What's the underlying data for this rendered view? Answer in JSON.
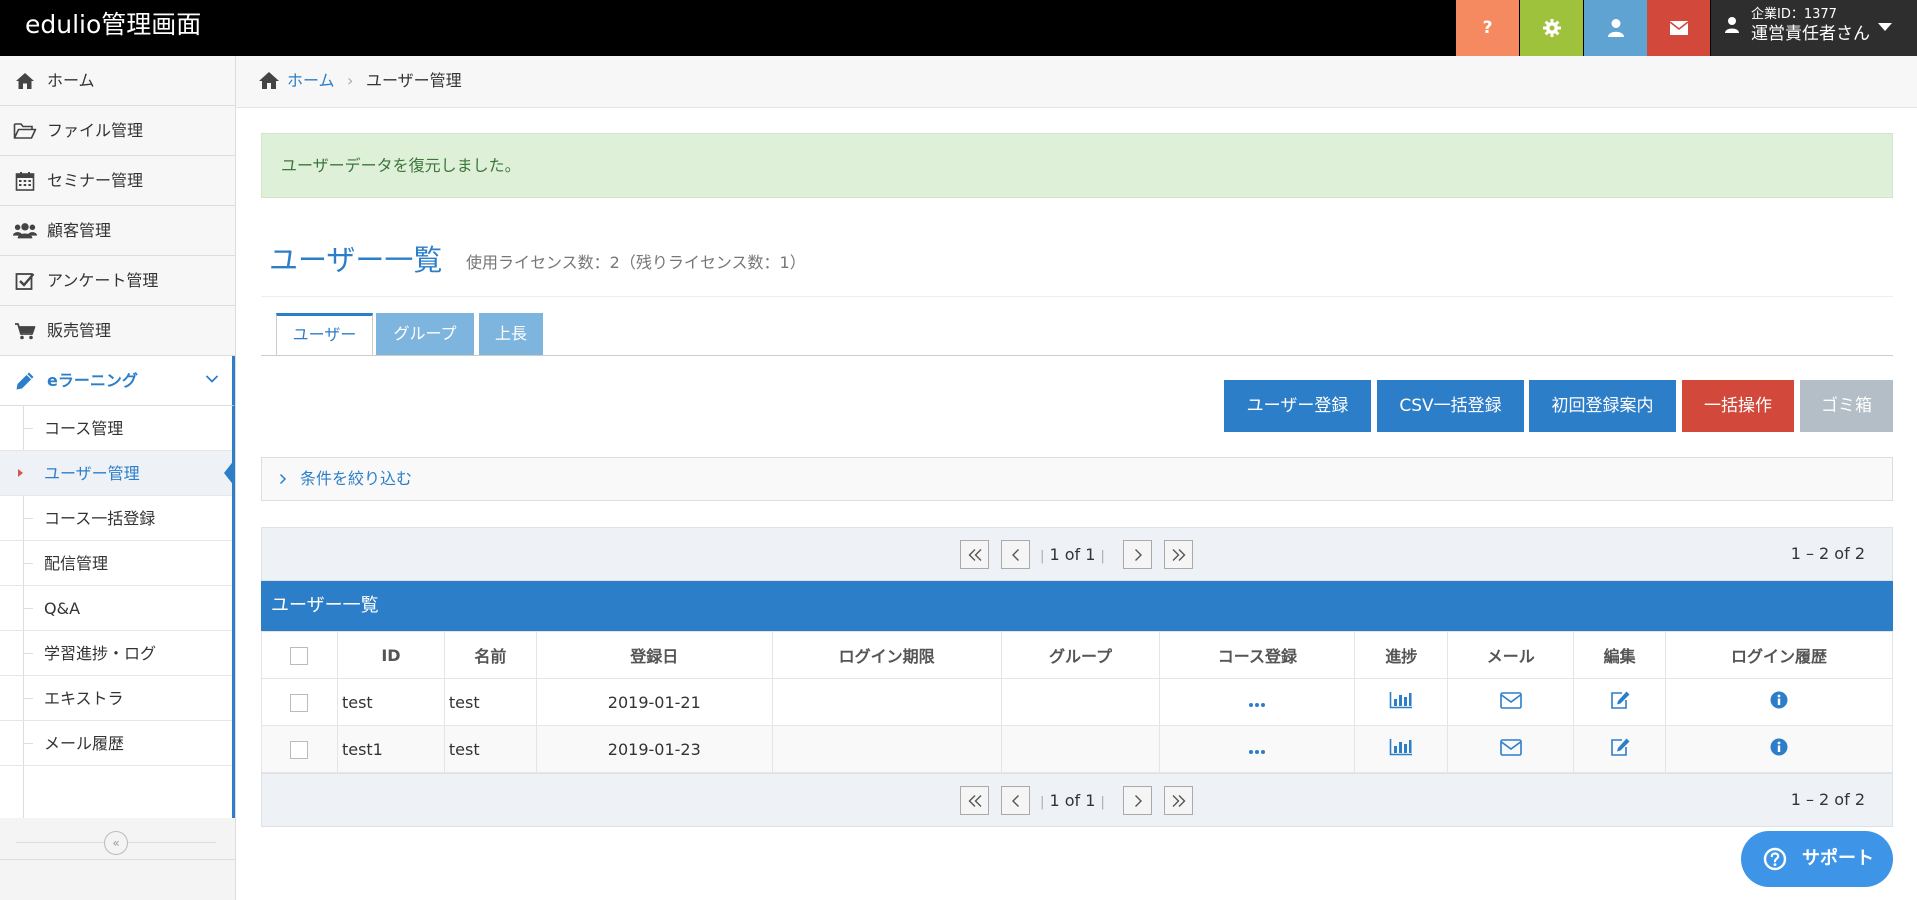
{
  "header": {
    "brand": "edulio管理画面",
    "help_label": "?",
    "company_id": "企業ID：1377",
    "user_name": "運営責任者さん"
  },
  "sidebar": {
    "items": [
      {
        "label": "ホーム",
        "icon": "home-icon"
      },
      {
        "label": "ファイル管理",
        "icon": "folder-open-icon"
      },
      {
        "label": "セミナー管理",
        "icon": "calendar-icon"
      },
      {
        "label": "顧客管理",
        "icon": "users-icon"
      },
      {
        "label": "アンケート管理",
        "icon": "checkbox-icon"
      },
      {
        "label": "販売管理",
        "icon": "cart-icon"
      },
      {
        "label": "eラーニング",
        "icon": "pencil-icon"
      }
    ],
    "subitems": [
      {
        "label": "コース管理"
      },
      {
        "label": "ユーザー管理"
      },
      {
        "label": "コース一括登録"
      },
      {
        "label": "配信管理"
      },
      {
        "label": "Q&A"
      },
      {
        "label": "学習進捗・ログ"
      },
      {
        "label": "エキストラ"
      },
      {
        "label": "メール履歴"
      }
    ],
    "collapse_label": "«"
  },
  "breadcrumb": {
    "home": "ホーム",
    "separator": "›",
    "current": "ユーザー管理"
  },
  "alert": {
    "message": "ユーザーデータを復元しました。"
  },
  "page": {
    "title": "ユーザー一覧",
    "license_info": "使用ライセンス数：2（残りライセンス数：1）"
  },
  "tabs": [
    {
      "label": "ユーザー"
    },
    {
      "label": "グループ"
    },
    {
      "label": "上長"
    }
  ],
  "actions": {
    "register": "ユーザー登録",
    "csv": "CSV一括登録",
    "first_guide": "初回登録案内",
    "bulk": "一括操作",
    "trash": "ゴミ箱"
  },
  "filter": {
    "label": "条件を絞り込む"
  },
  "pager": {
    "page_text": "1 of 1",
    "bar": "|",
    "count_text": "1 – 2 of 2"
  },
  "grid": {
    "title": "ユーザー一覧",
    "columns": [
      "ID",
      "名前",
      "登録日",
      "ログイン期限",
      "グループ",
      "コース登録",
      "進捗",
      "メール",
      "編集",
      "ログイン履歴"
    ],
    "rows": [
      {
        "id": "test",
        "name": "test",
        "date": "2019-01-21",
        "expire": "",
        "group": ""
      },
      {
        "id": "test1",
        "name": "test",
        "date": "2019-01-23",
        "expire": "",
        "group": ""
      }
    ]
  },
  "support": {
    "label": "サポート"
  },
  "colors": {
    "primary": "#2d7ec9",
    "danger": "#d2483a",
    "success_bg": "#dff0d8"
  }
}
